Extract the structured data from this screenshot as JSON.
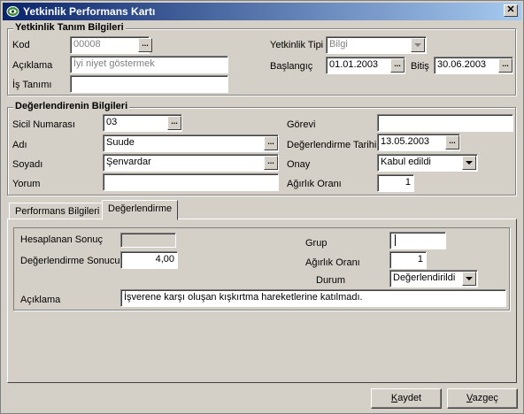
{
  "window": {
    "title": "Yetkinlik Performans Kartı",
    "close_glyph": "✕"
  },
  "group1": {
    "legend": "Yetkinlik Tanım Bilgileri",
    "kod_label": "Kod",
    "kod_value": "00008",
    "aciklama_label": "Açıklama",
    "aciklama_value": "İyi niyet göstermek",
    "is_tanimi_label": "İş Tanımı",
    "is_tanimi_value": "",
    "yetkinlik_tipi_label": "Yetkinlik Tipi",
    "yetkinlik_tipi_value": "Bilgi",
    "baslangic_label": "Başlangıç",
    "baslangic_value": "01.01.2003",
    "bitis_label": "Bitiş",
    "bitis_value": "30.06.2003"
  },
  "group2": {
    "legend": "Değerlendirenin Bilgileri",
    "sicil_label": "Sicil Numarası",
    "sicil_value": "03",
    "adi_label": "Adı",
    "adi_value": "Suude",
    "soyadi_label": "Soyadı",
    "soyadi_value": "Şenvardar",
    "yorum_label": "Yorum",
    "yorum_value": "",
    "gorevi_label": "Görevi",
    "gorevi_value": "",
    "deg_tarihi_label": "Değerlendirme Tarihi",
    "deg_tarihi_value": "13.05.2003",
    "onay_label": "Onay",
    "onay_value": "Kabul edildi",
    "agirlik_label": "Ağırlık Oranı",
    "agirlik_value": "1"
  },
  "tabs": [
    {
      "label": "Performans Bilgileri"
    },
    {
      "label": "Değerlendirme"
    }
  ],
  "tab_panel": {
    "hesaplanan_label": "Hesaplanan Sonuç",
    "hesaplanan_value": "",
    "deg_sonucu_label": "Değerlendirme Sonucu",
    "deg_sonucu_value": "4,00",
    "grup_label": "Grup",
    "grup_value": "",
    "agirlik_label": "Ağırlık Oranı",
    "agirlik_value": "1",
    "durum_label": "Durum",
    "durum_value": "Değerlendirildi",
    "aciklama_label": "Açıklama",
    "aciklama_value": "İşverene karşı oluşan kışkırtma hareketlerine katılmadı."
  },
  "footer": {
    "kaydet_first": "K",
    "kaydet_rest": "aydet",
    "vazgec_first": "V",
    "vazgec_rest": "azgeç"
  },
  "icons": {
    "title_icon": "eye-icon",
    "ellipsis": "..."
  },
  "colors": {
    "title_bar_start": "#0a246a",
    "title_bar_end": "#a6caf0",
    "window_bg": "#d4d0c8"
  }
}
